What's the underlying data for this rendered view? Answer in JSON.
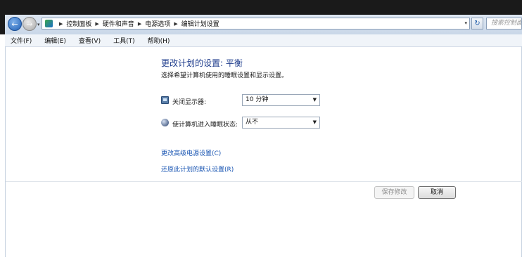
{
  "navigation": {
    "back_icon": "back-arrow-icon",
    "forward_icon": "forward-arrow-icon",
    "history_dropdown_icon": "chevron-down-icon",
    "location_icon": "control-panel-icon"
  },
  "address_bar": {
    "breadcrumbs": [
      "控制面板",
      "硬件和声音",
      "电源选项",
      "编辑计划设置"
    ],
    "dropdown_icon": "chevron-down-icon",
    "refresh_icon": "refresh-icon"
  },
  "search": {
    "placeholder": "搜索控制面板"
  },
  "menu": {
    "items": [
      "文件(F)",
      "编辑(E)",
      "查看(V)",
      "工具(T)",
      "帮助(H)"
    ]
  },
  "content": {
    "title": "更改计划的设置: 平衡",
    "subtitle": "选择希望计算机使用的睡眠设置和显示设置。",
    "settings": [
      {
        "icon": "display-icon",
        "label": "关闭显示器:",
        "value": "10 分钟"
      },
      {
        "icon": "sleep-icon",
        "label": "使计算机进入睡眠状态:",
        "value": "从不"
      }
    ],
    "links": [
      "更改高级电源设置(C)",
      "还原此计划的默认设置(R)"
    ]
  },
  "buttons": {
    "save": "保存修改",
    "cancel": "取消"
  }
}
